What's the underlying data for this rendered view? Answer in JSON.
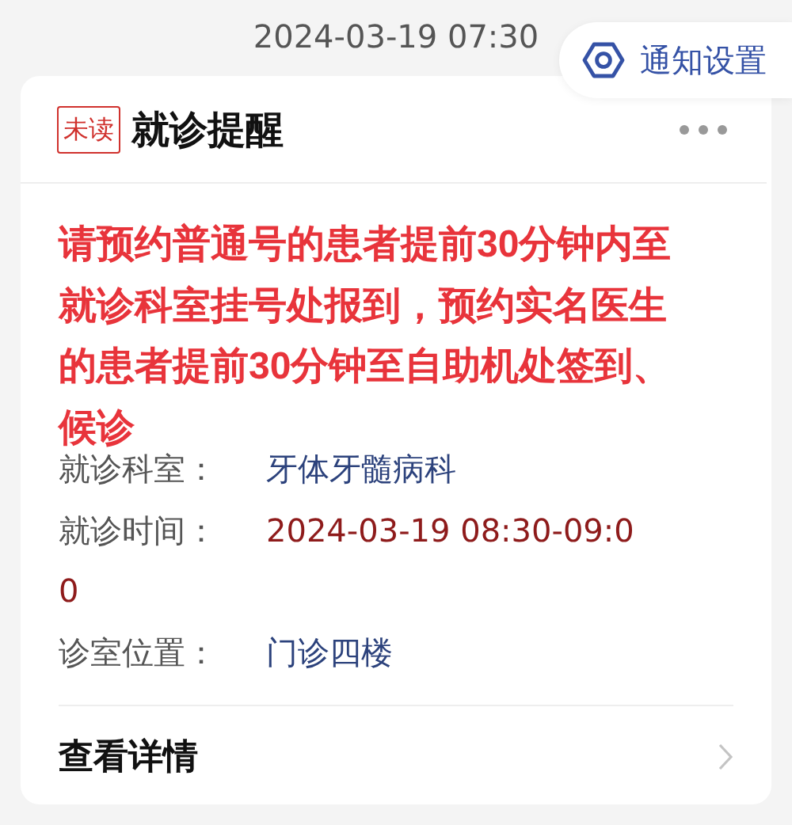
{
  "timestamp": "2024-03-19 07:30",
  "settings_button": {
    "label": "通知设置"
  },
  "card": {
    "badge": "未读",
    "unread": true,
    "title": "就诊提醒",
    "message": "请预约普通号的患者提前30分钟内至就诊科室挂号处报到，预约实名医生的患者提前30分钟至自助机处签到、候诊",
    "fields": [
      {
        "label": "就诊科室：",
        "value": "牙体牙髓病科",
        "highlight": false
      },
      {
        "label": "就诊时间：",
        "value": "2024-03-19 08:30-09:00",
        "highlight": true
      },
      {
        "label": "诊室位置：",
        "value": "门诊四楼",
        "highlight": false
      }
    ],
    "footer_link": "查看详情"
  }
}
